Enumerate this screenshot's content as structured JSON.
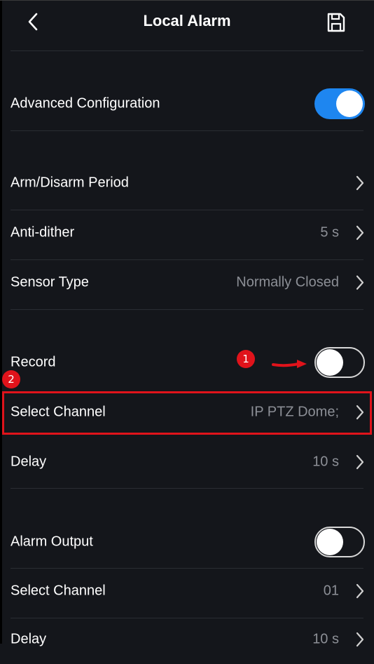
{
  "header": {
    "title": "Local Alarm",
    "back_icon": "chevron-left-icon",
    "save_icon": "save-icon"
  },
  "rows": {
    "advanced": {
      "label": "Advanced Configuration",
      "toggle": "on"
    },
    "arm_disarm": {
      "label": "Arm/Disarm Period"
    },
    "anti_dither": {
      "label": "Anti-dither",
      "value": "5 s"
    },
    "sensor_type": {
      "label": "Sensor Type",
      "value": "Normally Closed"
    },
    "record": {
      "label": "Record",
      "toggle": "off"
    },
    "select_channel_1": {
      "label": "Select Channel",
      "value": "IP PTZ Dome;"
    },
    "delay_1": {
      "label": "Delay",
      "value": "10 s"
    },
    "alarm_output": {
      "label": "Alarm Output",
      "toggle": "off"
    },
    "select_channel_2": {
      "label": "Select Channel",
      "value": "01"
    },
    "delay_2": {
      "label": "Delay",
      "value": "10 s"
    }
  },
  "annotations": {
    "badge_1": "1",
    "badge_2": "2",
    "accent_color": "#e0131b"
  },
  "colors": {
    "toggle_on": "#1e86f0",
    "background": "#14161b",
    "secondary_text": "#8c8f96"
  }
}
